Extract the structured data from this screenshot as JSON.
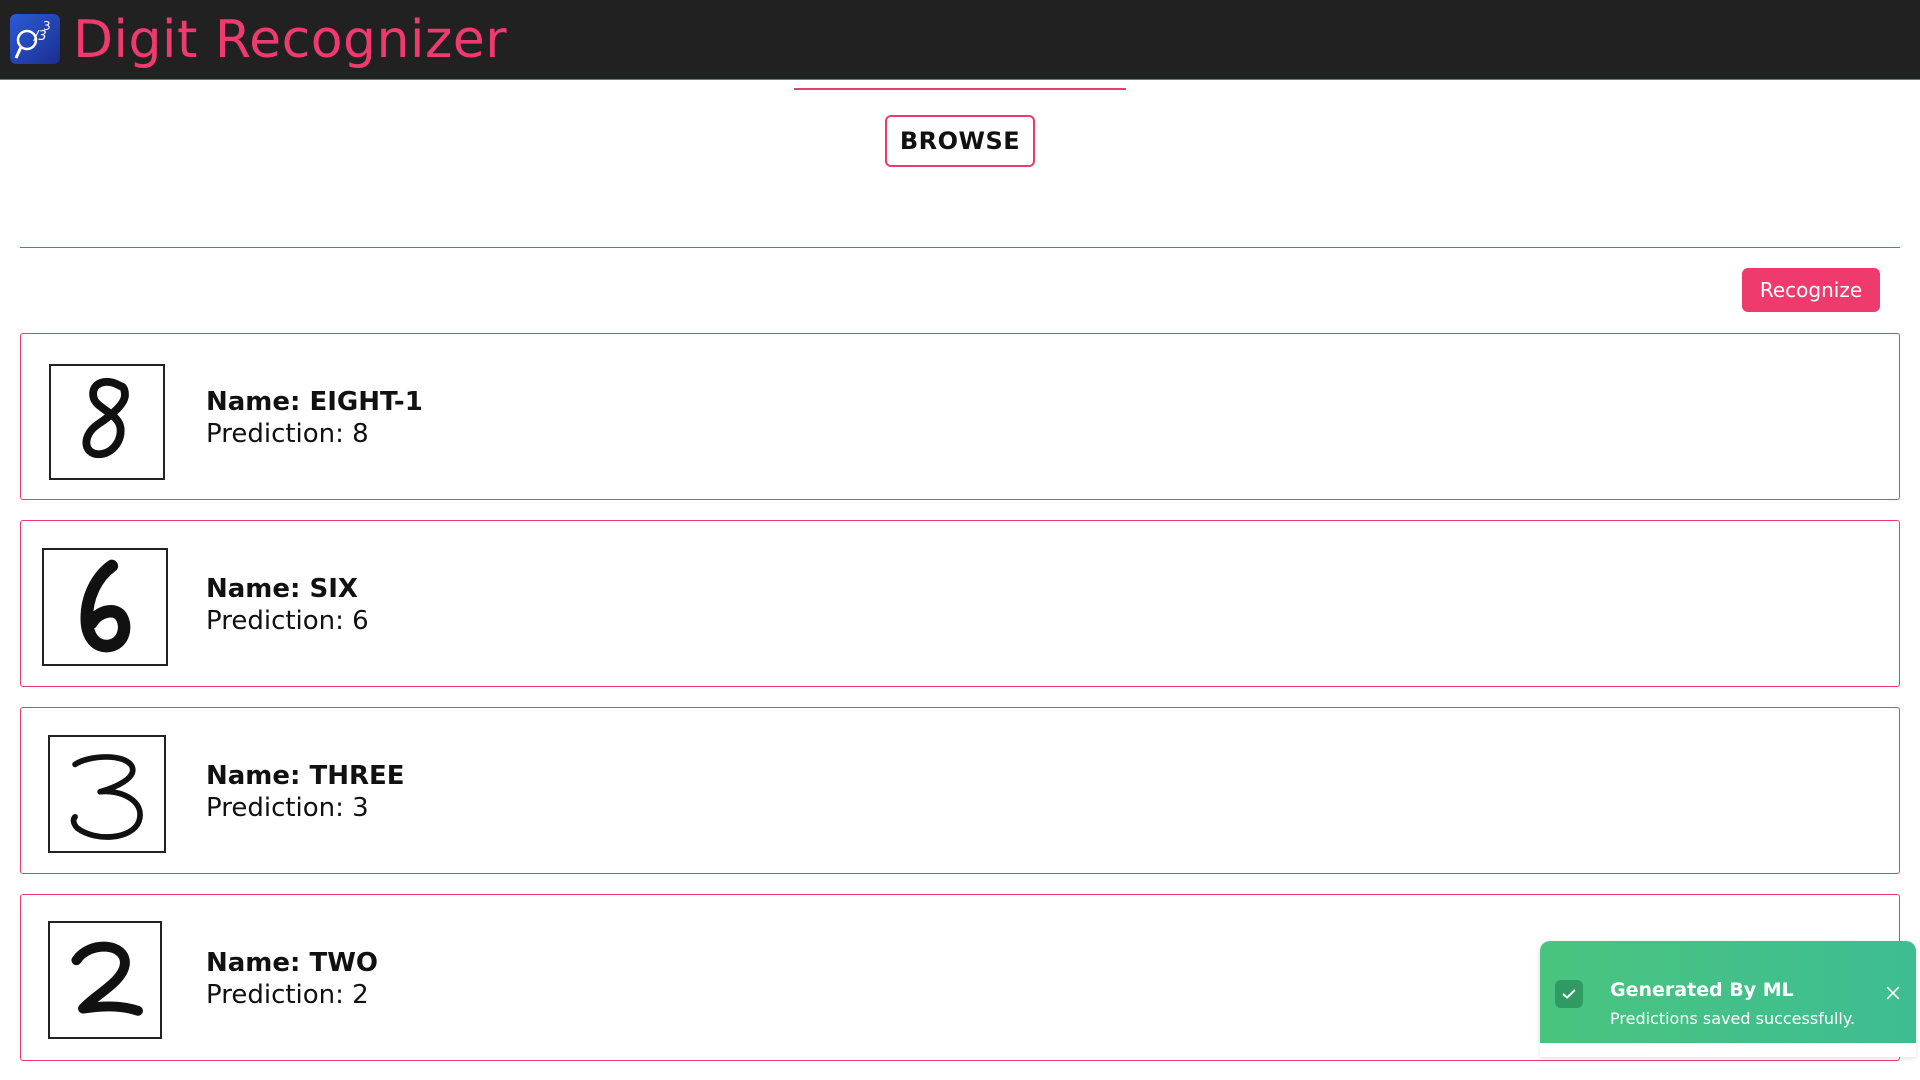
{
  "app": {
    "title": "Digit Recognizer"
  },
  "toolbar": {
    "browse_label": "BROWSE",
    "recognize_label": "Recognize"
  },
  "results": [
    {
      "name_label": "Name: EIGHT-1",
      "prediction_label": "Prediction: 8",
      "digit": "8"
    },
    {
      "name_label": "Name: SIX",
      "prediction_label": "Prediction: 6",
      "digit": "6"
    },
    {
      "name_label": "Name: THREE",
      "prediction_label": "Prediction: 3",
      "digit": "3"
    },
    {
      "name_label": "Name: TWO",
      "prediction_label": "Prediction: 2",
      "digit": "2"
    }
  ],
  "toast": {
    "title": "Generated By ML",
    "message": "Predictions saved successfully.",
    "icon": "check-icon",
    "close_icon": "close-icon"
  },
  "colors": {
    "accent": "#ef3a6e",
    "header_bg": "#212121",
    "toast_bg": "#46c284"
  }
}
